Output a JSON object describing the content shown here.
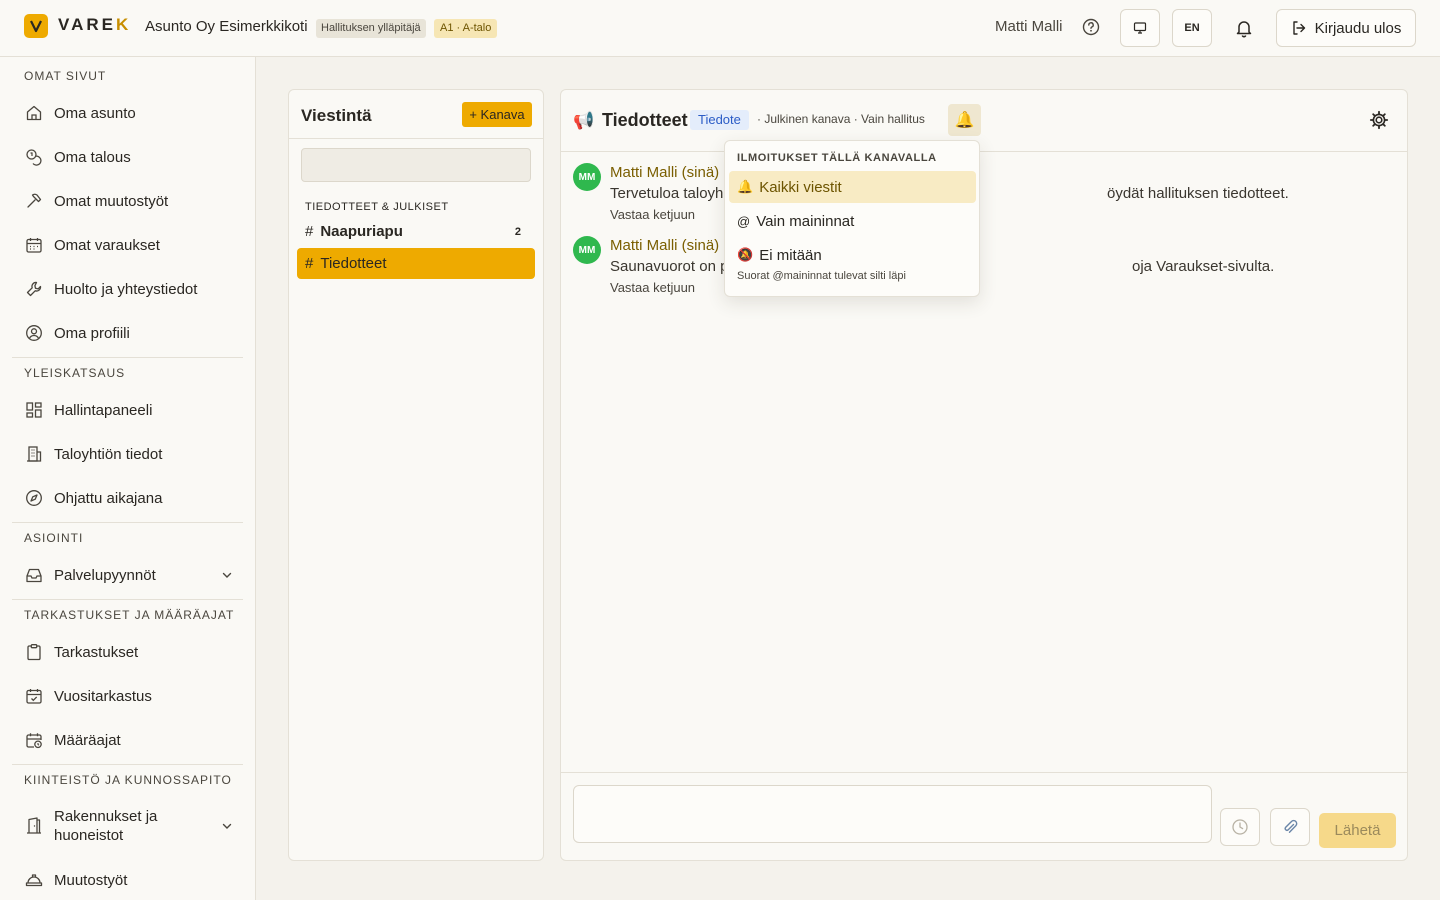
{
  "header": {
    "logo_text_main": "VARE",
    "logo_text_accent": "K",
    "org_name": "Asunto Oy Esimerkkikoti",
    "role_badge": "Hallituksen ylläpitäjä",
    "apartment_badge": "A1 · A-talo",
    "user_name": "Matti Malli",
    "language": "EN",
    "logout_label": "Kirjaudu ulos"
  },
  "sidebar": {
    "sections": [
      {
        "title": "OMAT SIVUT",
        "items": [
          {
            "label": "Oma asunto",
            "icon": "home-icon"
          },
          {
            "label": "Oma talous",
            "icon": "coins-icon"
          },
          {
            "label": "Omat muutostyöt",
            "icon": "hammer-icon"
          },
          {
            "label": "Omat varaukset",
            "icon": "calendar-icon"
          },
          {
            "label": "Huolto ja yhteystiedot",
            "icon": "wrench-icon"
          },
          {
            "label": "Oma profiili",
            "icon": "user-circle-icon"
          }
        ]
      },
      {
        "title": "YLEISKATSAUS",
        "items": [
          {
            "label": "Hallintapaneeli",
            "icon": "dashboard-icon"
          },
          {
            "label": "Taloyhtiön tiedot",
            "icon": "building-icon"
          },
          {
            "label": "Ohjattu aikajana",
            "icon": "compass-icon"
          }
        ]
      },
      {
        "title": "ASIOINTI",
        "items": [
          {
            "label": "Palvelupyynnöt",
            "icon": "inbox-icon",
            "expandable": true
          }
        ]
      },
      {
        "title": "TARKASTUKSET JA MÄÄRÄAJAT",
        "items": [
          {
            "label": "Tarkastukset",
            "icon": "clipboard-icon"
          },
          {
            "label": "Vuositarkastus",
            "icon": "calendar-check-icon"
          },
          {
            "label": "Määräajat",
            "icon": "calendar-clock-icon"
          }
        ]
      },
      {
        "title": "KIINTEISTÖ JA KUNNOSSAPITO",
        "items": [
          {
            "label": "Rakennukset ja huoneistot",
            "icon": "door-icon",
            "expandable": true
          },
          {
            "label": "Muutostyöt",
            "icon": "hard-hat-icon"
          }
        ]
      }
    ]
  },
  "channels": {
    "title": "Viestintä",
    "add_label": "+ Kanava",
    "search_placeholder": "",
    "group_title": "TIEDOTTEET & JULKISET",
    "items": [
      {
        "name": "Naapuriapu",
        "unread": "2",
        "bold": true,
        "active": false
      },
      {
        "name": "Tiedotteet",
        "unread": "",
        "bold": false,
        "active": true
      }
    ]
  },
  "chat": {
    "icon": "megaphone-icon",
    "title": "Tiedotteet",
    "tag": "Tiedote",
    "meta": "· Julkinen kanava · Vain hallitus",
    "messages": [
      {
        "initials": "MM",
        "author": "Matti Malli (sinä)",
        "text_start": "Tervetuloa taloyh",
        "text_end": "öydät hallituksen tiedotteet.",
        "reply": "Vastaa ketjuun"
      },
      {
        "initials": "MM",
        "author": "Matti Malli (sinä)",
        "text_start": "Saunavuorot on p",
        "text_end": "oja Varaukset-sivulta.",
        "reply": "Vastaa ketjuun"
      }
    ],
    "composer_placeholder": "",
    "send_label": "Lähetä"
  },
  "notification_menu": {
    "title": "ILMOITUKSET TÄLLÄ KANAVALLA",
    "options": [
      {
        "icon": "🔔",
        "label": "Kaikki viestit",
        "selected": true
      },
      {
        "icon": "@",
        "label": "Vain maininnat",
        "selected": false
      },
      {
        "icon": "🔕",
        "label": "Ei mitään",
        "selected": false
      }
    ],
    "note": "Suorat @maininnat tulevat silti läpi"
  },
  "colors": {
    "accent": "#eeaa00",
    "avatar": "#2fb84e",
    "author": "#7a5e00",
    "tag_bg": "#e4edfb",
    "tag_text": "#2b5cc6"
  }
}
